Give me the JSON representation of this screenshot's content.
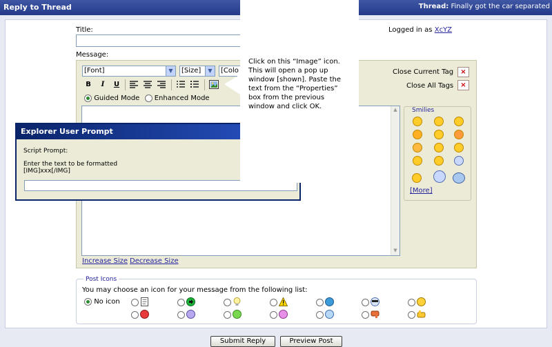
{
  "header": {
    "title": "Reply to Thread",
    "thread_label": "Thread:",
    "thread_title": "Finally got the car separated"
  },
  "form": {
    "title_label": "Title:",
    "logged_in_prefix": "Logged in as",
    "username": "XcYZ",
    "message_label": "Message:"
  },
  "editor": {
    "font_select": "[Font]",
    "size_select": "[Size]",
    "color_select": "[Colo",
    "bold": "B",
    "italic": "I",
    "underline": "U",
    "guided_mode": "Guided Mode",
    "enhanced_mode": "Enhanced Mode",
    "close_current_tag": "Close Current Tag",
    "close_all_tags": "Close All Tags",
    "x_glyph": "×",
    "increase_size": "Increase Size",
    "decrease_size": "Decrease Size"
  },
  "smilies": {
    "title": "Smilies",
    "more": "[More]"
  },
  "prompt": {
    "title": "Explorer User Prompt",
    "script_prompt": "Script Prompt:",
    "line1": "Enter the text to be formatted",
    "line2": "[IMG]xxx[/IMG]"
  },
  "callout": {
    "text": "Click on this “Image” icon.  This will open a pop up window [shown].  Paste the text from the “Properties” box from the previous window and click OK."
  },
  "post_icons": {
    "legend": "Post Icons",
    "instructions": "You may choose an icon for your message from the following list:",
    "no_icon": "No icon",
    "selected": "No icon"
  },
  "buttons": {
    "submit": "Submit Reply",
    "preview": "Preview Post"
  },
  "colors": {
    "header": "#24398a",
    "accent": "#22229c",
    "editor_bg": "#ecebd8",
    "prompt_title": "#0a246a"
  }
}
